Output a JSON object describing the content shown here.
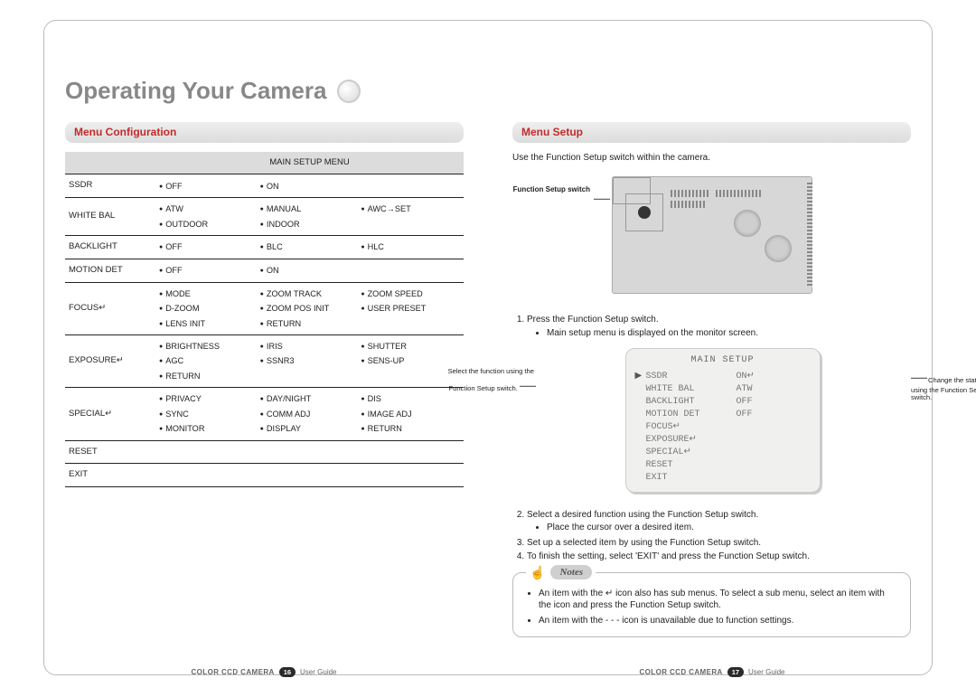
{
  "title": "Operating Your Camera",
  "left": {
    "heading": "Menu Configuration",
    "table_caption": "MAIN SETUP MENU",
    "rows": [
      {
        "name": "SSDR",
        "opts": [
          "OFF",
          "ON"
        ]
      },
      {
        "name": "WHITE BAL",
        "opts": [
          "ATW",
          "MANUAL",
          "AWC→SET",
          "OUTDOOR",
          "INDOOR"
        ]
      },
      {
        "name": "BACKLIGHT",
        "opts": [
          "OFF",
          "BLC",
          "HLC"
        ]
      },
      {
        "name": "MOTION DET",
        "opts": [
          "OFF",
          "ON"
        ]
      },
      {
        "name": "FOCUS↵",
        "opts": [
          "MODE",
          "ZOOM TRACK",
          "ZOOM SPEED",
          "D-ZOOM",
          "ZOOM POS INIT",
          "USER PRESET",
          "LENS INIT",
          "RETURN"
        ]
      },
      {
        "name": "EXPOSURE↵",
        "opts": [
          "BRIGHTNESS",
          "IRIS",
          "SHUTTER",
          "AGC",
          "SSNR3",
          "SENS-UP",
          "RETURN"
        ]
      },
      {
        "name": "SPECIAL↵",
        "opts": [
          "PRIVACY",
          "DAY/NIGHT",
          "DIS",
          "SYNC",
          "COMM ADJ",
          "IMAGE ADJ",
          "MONITOR",
          "DISPLAY",
          "RETURN"
        ]
      },
      {
        "name": "RESET",
        "opts": []
      },
      {
        "name": "EXIT",
        "opts": []
      }
    ]
  },
  "right": {
    "heading": "Menu Setup",
    "intro": "Use the Function Setup switch within the camera.",
    "switch_label": "Function Setup switch",
    "step1": "Press the Function Setup switch.",
    "step1_sub": "Main setup menu is displayed on the monitor screen.",
    "osd_left_hint": "Select the function using the Function Setup switch.",
    "osd_right_hint": "Change the status using the Function Setup switch.",
    "osd_title": "MAIN SETUP",
    "osd": [
      {
        "ptr": "▶",
        "name": "SSDR",
        "val": "ON↵"
      },
      {
        "ptr": "",
        "name": "WHITE BAL",
        "val": "ATW"
      },
      {
        "ptr": "",
        "name": "BACKLIGHT",
        "val": "OFF"
      },
      {
        "ptr": "",
        "name": "MOTION DET",
        "val": "OFF"
      },
      {
        "ptr": "",
        "name": "FOCUS↵",
        "val": ""
      },
      {
        "ptr": "",
        "name": "EXPOSURE↵",
        "val": ""
      },
      {
        "ptr": "",
        "name": "SPECIAL↵",
        "val": ""
      },
      {
        "ptr": "",
        "name": "RESET",
        "val": ""
      },
      {
        "ptr": "",
        "name": "EXIT",
        "val": ""
      }
    ],
    "step2": "Select a desired function using the Function Setup switch.",
    "step2_sub": "Place the cursor over a desired item.",
    "step3": "Set up a selected item by using the Function Setup switch.",
    "step4": "To finish the setting, select 'EXIT' and press the Function Setup switch.",
    "notes_label": "Notes",
    "note1": "An item with the ↵ icon also has sub menus. To select a sub menu, select an item with the icon and press the Function Setup switch.",
    "note2": "An item with the - - - icon is unavailable due to function settings."
  },
  "footer": {
    "product": "COLOR CCD CAMERA",
    "guide": "User Guide",
    "left_page": "16",
    "right_page": "17"
  }
}
